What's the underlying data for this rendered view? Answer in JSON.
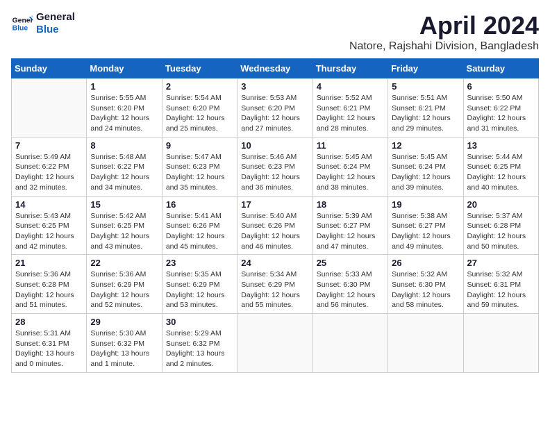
{
  "header": {
    "logo_line1": "General",
    "logo_line2": "Blue",
    "month_title": "April 2024",
    "location": "Natore, Rajshahi Division, Bangladesh"
  },
  "weekdays": [
    "Sunday",
    "Monday",
    "Tuesday",
    "Wednesday",
    "Thursday",
    "Friday",
    "Saturday"
  ],
  "weeks": [
    [
      {
        "day": "",
        "info": ""
      },
      {
        "day": "1",
        "info": "Sunrise: 5:55 AM\nSunset: 6:20 PM\nDaylight: 12 hours\nand 24 minutes."
      },
      {
        "day": "2",
        "info": "Sunrise: 5:54 AM\nSunset: 6:20 PM\nDaylight: 12 hours\nand 25 minutes."
      },
      {
        "day": "3",
        "info": "Sunrise: 5:53 AM\nSunset: 6:20 PM\nDaylight: 12 hours\nand 27 minutes."
      },
      {
        "day": "4",
        "info": "Sunrise: 5:52 AM\nSunset: 6:21 PM\nDaylight: 12 hours\nand 28 minutes."
      },
      {
        "day": "5",
        "info": "Sunrise: 5:51 AM\nSunset: 6:21 PM\nDaylight: 12 hours\nand 29 minutes."
      },
      {
        "day": "6",
        "info": "Sunrise: 5:50 AM\nSunset: 6:22 PM\nDaylight: 12 hours\nand 31 minutes."
      }
    ],
    [
      {
        "day": "7",
        "info": "Sunrise: 5:49 AM\nSunset: 6:22 PM\nDaylight: 12 hours\nand 32 minutes."
      },
      {
        "day": "8",
        "info": "Sunrise: 5:48 AM\nSunset: 6:22 PM\nDaylight: 12 hours\nand 34 minutes."
      },
      {
        "day": "9",
        "info": "Sunrise: 5:47 AM\nSunset: 6:23 PM\nDaylight: 12 hours\nand 35 minutes."
      },
      {
        "day": "10",
        "info": "Sunrise: 5:46 AM\nSunset: 6:23 PM\nDaylight: 12 hours\nand 36 minutes."
      },
      {
        "day": "11",
        "info": "Sunrise: 5:45 AM\nSunset: 6:24 PM\nDaylight: 12 hours\nand 38 minutes."
      },
      {
        "day": "12",
        "info": "Sunrise: 5:45 AM\nSunset: 6:24 PM\nDaylight: 12 hours\nand 39 minutes."
      },
      {
        "day": "13",
        "info": "Sunrise: 5:44 AM\nSunset: 6:25 PM\nDaylight: 12 hours\nand 40 minutes."
      }
    ],
    [
      {
        "day": "14",
        "info": "Sunrise: 5:43 AM\nSunset: 6:25 PM\nDaylight: 12 hours\nand 42 minutes."
      },
      {
        "day": "15",
        "info": "Sunrise: 5:42 AM\nSunset: 6:25 PM\nDaylight: 12 hours\nand 43 minutes."
      },
      {
        "day": "16",
        "info": "Sunrise: 5:41 AM\nSunset: 6:26 PM\nDaylight: 12 hours\nand 45 minutes."
      },
      {
        "day": "17",
        "info": "Sunrise: 5:40 AM\nSunset: 6:26 PM\nDaylight: 12 hours\nand 46 minutes."
      },
      {
        "day": "18",
        "info": "Sunrise: 5:39 AM\nSunset: 6:27 PM\nDaylight: 12 hours\nand 47 minutes."
      },
      {
        "day": "19",
        "info": "Sunrise: 5:38 AM\nSunset: 6:27 PM\nDaylight: 12 hours\nand 49 minutes."
      },
      {
        "day": "20",
        "info": "Sunrise: 5:37 AM\nSunset: 6:28 PM\nDaylight: 12 hours\nand 50 minutes."
      }
    ],
    [
      {
        "day": "21",
        "info": "Sunrise: 5:36 AM\nSunset: 6:28 PM\nDaylight: 12 hours\nand 51 minutes."
      },
      {
        "day": "22",
        "info": "Sunrise: 5:36 AM\nSunset: 6:29 PM\nDaylight: 12 hours\nand 52 minutes."
      },
      {
        "day": "23",
        "info": "Sunrise: 5:35 AM\nSunset: 6:29 PM\nDaylight: 12 hours\nand 53 minutes."
      },
      {
        "day": "24",
        "info": "Sunrise: 5:34 AM\nSunset: 6:29 PM\nDaylight: 12 hours\nand 55 minutes."
      },
      {
        "day": "25",
        "info": "Sunrise: 5:33 AM\nSunset: 6:30 PM\nDaylight: 12 hours\nand 56 minutes."
      },
      {
        "day": "26",
        "info": "Sunrise: 5:32 AM\nSunset: 6:30 PM\nDaylight: 12 hours\nand 58 minutes."
      },
      {
        "day": "27",
        "info": "Sunrise: 5:32 AM\nSunset: 6:31 PM\nDaylight: 12 hours\nand 59 minutes."
      }
    ],
    [
      {
        "day": "28",
        "info": "Sunrise: 5:31 AM\nSunset: 6:31 PM\nDaylight: 13 hours\nand 0 minutes."
      },
      {
        "day": "29",
        "info": "Sunrise: 5:30 AM\nSunset: 6:32 PM\nDaylight: 13 hours\nand 1 minute."
      },
      {
        "day": "30",
        "info": "Sunrise: 5:29 AM\nSunset: 6:32 PM\nDaylight: 13 hours\nand 2 minutes."
      },
      {
        "day": "",
        "info": ""
      },
      {
        "day": "",
        "info": ""
      },
      {
        "day": "",
        "info": ""
      },
      {
        "day": "",
        "info": ""
      }
    ]
  ]
}
